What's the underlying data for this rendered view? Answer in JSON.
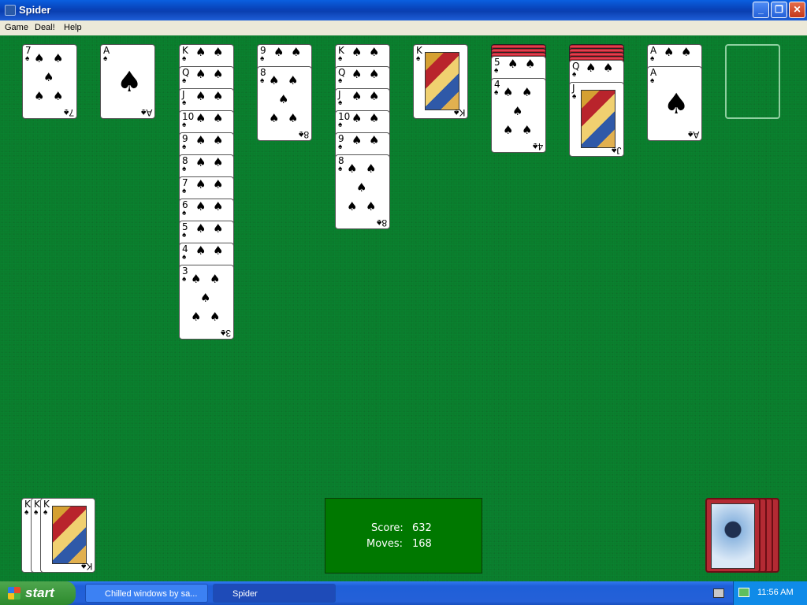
{
  "window": {
    "title": "Spider",
    "minimize": "_",
    "maximize": "❐",
    "close": "✕"
  },
  "menu": [
    "Game",
    "Deal!",
    "Help"
  ],
  "colors": {
    "felt": "#0b7c2c",
    "score_panel": "#007800",
    "card_back": "#b0202c"
  },
  "tableau": [
    {
      "hidden": 0,
      "cards": [
        "7♠"
      ]
    },
    {
      "hidden": 0,
      "cards": [
        "A♠"
      ]
    },
    {
      "hidden": 0,
      "cards": [
        "K♠",
        "Q♠",
        "J♠",
        "10♠",
        "9♠",
        "8♠",
        "7♠",
        "6♠",
        "5♠",
        "4♠",
        "3♠"
      ]
    },
    {
      "hidden": 0,
      "cards": [
        "9♠",
        "8♠"
      ]
    },
    {
      "hidden": 0,
      "cards": [
        "K♠",
        "Q♠",
        "J♠",
        "10♠",
        "9♠",
        "8♠"
      ]
    },
    {
      "hidden": 0,
      "cards": [
        "K♠"
      ]
    },
    {
      "hidden": 3,
      "cards": [
        "5♠",
        "4♠"
      ]
    },
    {
      "hidden": 4,
      "cards": [
        "Q♠",
        "J♠"
      ]
    },
    {
      "hidden": 0,
      "cards": [
        "A♠",
        "A♠"
      ]
    },
    {
      "hidden": 0,
      "cards": []
    }
  ],
  "foundation": {
    "label_cards": [
      "K",
      "K",
      "K"
    ],
    "suit": "♠"
  },
  "score": {
    "score_label": "Score:",
    "score_value": "632",
    "moves_label": "Moves:",
    "moves_value": "168"
  },
  "stock": {
    "piles": 4,
    "icon": "spider-icon"
  },
  "taskbar": {
    "start": "start",
    "tasks": [
      "Chilled windows by sa...",
      "Spider"
    ],
    "time": "11:56 AM"
  }
}
